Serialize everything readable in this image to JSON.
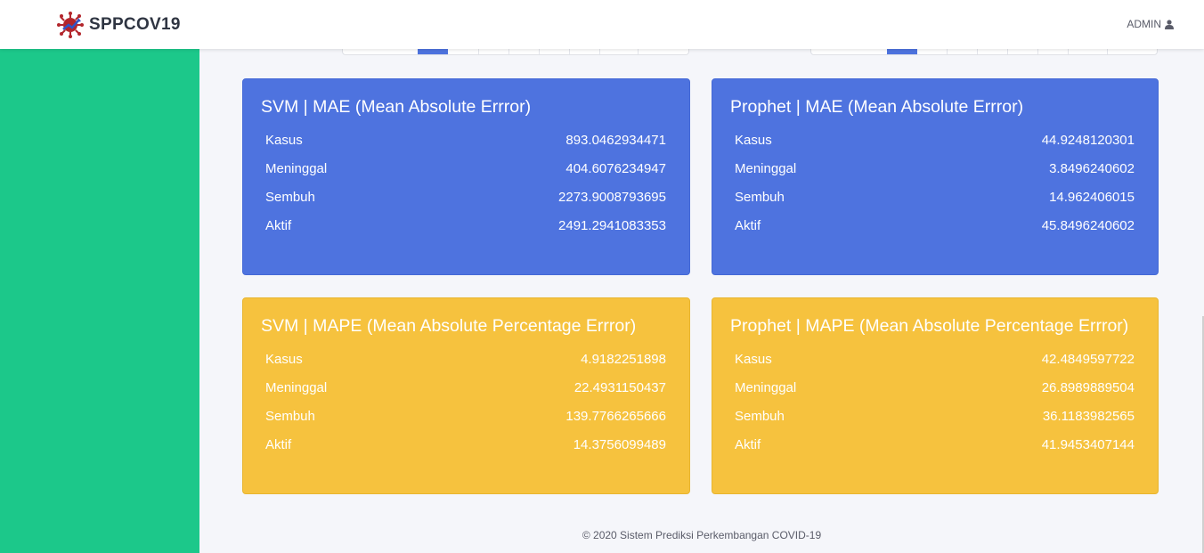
{
  "app": {
    "brand": "SPPCOV19",
    "user_label": "ADMIN"
  },
  "cards": [
    {
      "title": "SVM | MAE (Mean Absolute Errror)",
      "theme": "blue",
      "rows": [
        {
          "label": "Kasus",
          "value": "893.0462934471"
        },
        {
          "label": "Meninggal",
          "value": "404.6076234947"
        },
        {
          "label": "Sembuh",
          "value": "2273.9008793695"
        },
        {
          "label": "Aktif",
          "value": "2491.2941083353"
        }
      ]
    },
    {
      "title": "Prophet | MAE (Mean Absolute Errror)",
      "theme": "blue",
      "rows": [
        {
          "label": "Kasus",
          "value": "44.9248120301"
        },
        {
          "label": "Meninggal",
          "value": "3.8496240602"
        },
        {
          "label": "Sembuh",
          "value": "14.962406015"
        },
        {
          "label": "Aktif",
          "value": "45.8496240602"
        }
      ]
    },
    {
      "title": "SVM | MAPE (Mean Absolute Percentage Errror)",
      "theme": "yellow",
      "rows": [
        {
          "label": "Kasus",
          "value": "4.9182251898"
        },
        {
          "label": "Meninggal",
          "value": "22.4931150437"
        },
        {
          "label": "Sembuh",
          "value": "139.7766265666"
        },
        {
          "label": "Aktif",
          "value": "14.3756099489"
        }
      ]
    },
    {
      "title": "Prophet | MAPE (Mean Absolute Percentage Errror)",
      "theme": "yellow",
      "rows": [
        {
          "label": "Kasus",
          "value": "42.4849597722"
        },
        {
          "label": "Meninggal",
          "value": "26.8989889504"
        },
        {
          "label": "Sembuh",
          "value": "36.1183982565"
        },
        {
          "label": "Aktif",
          "value": "41.9453407144"
        }
      ]
    }
  ],
  "footer": {
    "text": "© 2020 Sistem Prediksi Perkembangan COVID-19"
  },
  "colors": {
    "sidebar": "#1cc88a",
    "blue": "#4e73df",
    "yellow": "#f6c23e",
    "background": "#f5f6fa"
  }
}
